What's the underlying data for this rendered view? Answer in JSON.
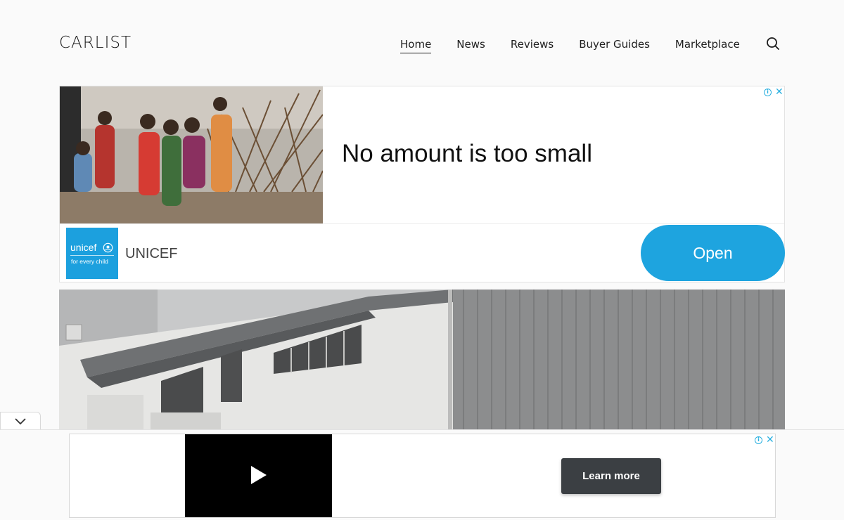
{
  "header": {
    "logo": "CARLIST",
    "nav": [
      {
        "label": "Home",
        "active": true
      },
      {
        "label": "News",
        "active": false
      },
      {
        "label": "Reviews",
        "active": false
      },
      {
        "label": "Buyer Guides",
        "active": false
      },
      {
        "label": "Marketplace",
        "active": false
      }
    ],
    "search_icon": "search-icon"
  },
  "ad_top": {
    "headline": "No amount is too small",
    "brand_name": "UNICEF",
    "logo_word": "unicef",
    "logo_tagline": "for every child",
    "cta_label": "Open",
    "accent_color": "#1ea4df",
    "info_icon": "info-icon",
    "close_icon": "close-icon"
  },
  "hero": {
    "image": "building-facade-photo"
  },
  "sticky_ad": {
    "collapse_icon": "chevron-down-icon",
    "play_icon": "play-icon",
    "cta_label": "Learn more",
    "info_icon": "info-icon",
    "close_icon": "close-icon"
  }
}
